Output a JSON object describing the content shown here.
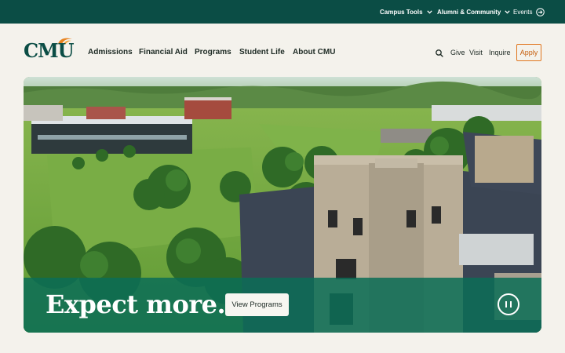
{
  "utility_bar": {
    "campus_tools": "Campus Tools",
    "alumni_community": "Alumni & Community",
    "events": "Events"
  },
  "logo": {
    "text": "CMU"
  },
  "nav": {
    "items": [
      "Admissions",
      "Financial Aid",
      "Programs",
      "Student Life",
      "About CMU"
    ]
  },
  "actions": {
    "give": "Give",
    "visit": "Visit",
    "inquire": "Inquire",
    "apply": "Apply"
  },
  "hero": {
    "headline": "Expect more.",
    "cta_label": "View Programs"
  },
  "icons": {
    "chevron": "chevron-down-icon",
    "events": "arrow-right-circle-icon",
    "search": "search-icon",
    "pause": "pause-icon"
  },
  "colors": {
    "utility_bar": "#0b4d45",
    "brand_green": "#0b4d45",
    "accent_orange": "#e0761f",
    "hero_band": "#0c6e56",
    "page_background": "#f4f2ec"
  }
}
